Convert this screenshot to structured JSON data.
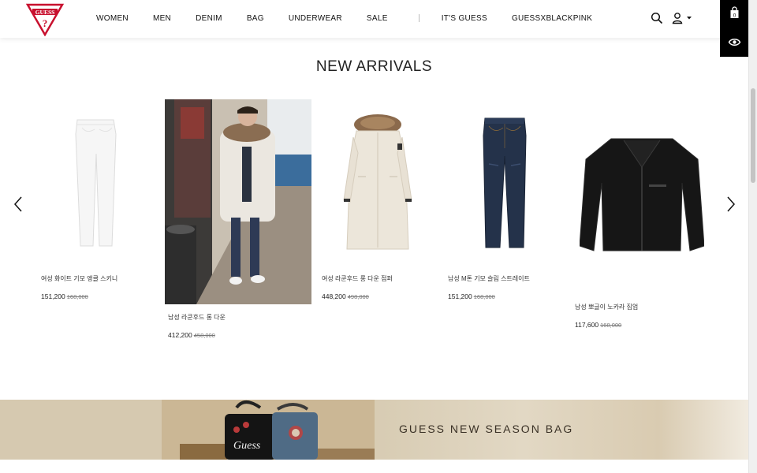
{
  "brand": {
    "logo_text": "GUESS"
  },
  "nav": {
    "items": [
      "WOMEN",
      "MEN",
      "DENIM",
      "BAG",
      "UNDERWEAR",
      "SALE"
    ],
    "extra": [
      "IT'S GUESS",
      "GUESSXBLACKPINK"
    ]
  },
  "header_icons": {
    "search": "search-icon",
    "user": "user-icon",
    "caret": "caret-down-icon"
  },
  "side_panel": {
    "cart": "shopping-bag-icon",
    "cart_count": "0",
    "recent": "eye-icon"
  },
  "section": {
    "title": "NEW ARRIVALS"
  },
  "products": [
    {
      "name": "여성 화이트 기모 앵클 스키니",
      "price": "151,200",
      "original": "168,000"
    },
    {
      "name": "남성 라쿤후드 롱 다운",
      "price": "412,200",
      "original": "458,000"
    },
    {
      "name": "여성 라쿤후드 롱 다운 점퍼",
      "price": "448,200",
      "original": "498,000"
    },
    {
      "name": "남성 M톤 기모 슬림 스트레이트",
      "price": "151,200",
      "original": "168,000"
    },
    {
      "name": "남성 뽀글이 노카라 집업",
      "price": "117,600",
      "original": "168,000"
    }
  ],
  "banner": {
    "title": "GUESS NEW SEASON BAG",
    "bag_text": "Guess"
  },
  "colors": {
    "accent": "#c8102e",
    "text": "#222222",
    "banner": "#c2ab86"
  }
}
